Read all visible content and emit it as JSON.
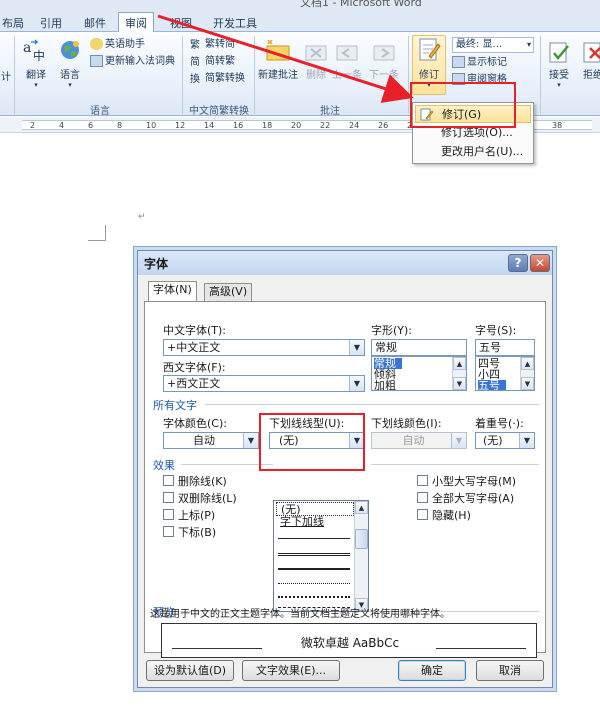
{
  "app": {
    "title": "文档1 - Microsoft Word"
  },
  "ribbon_tabs": [
    "布局",
    "引用",
    "邮件",
    "审阅",
    "视图",
    "开发工具"
  ],
  "ribbon": {
    "proof_group": {
      "label": "语言",
      "translate": "翻译",
      "language": "语言",
      "english_assistant": "英语助手",
      "update_ime": "更新输入法词典",
      "left_cut": "计"
    },
    "chinese_group": {
      "label": "中文简繁转换",
      "to_simplified": "繁转简",
      "to_traditional": "简转繁",
      "convert": "简繁转换"
    },
    "comments_group": {
      "label": "批注",
      "new_comment": "新建批注",
      "delete": "删除",
      "previous": "上一条",
      "next": "下一条"
    },
    "tracking_group": {
      "track_changes": "修订",
      "final_show_markup": "最终: 显...",
      "show_markup": "显示标记",
      "review_pane": "审阅窗格"
    },
    "changes_group": {
      "accept": "接受",
      "reject_cut": "拒绝"
    }
  },
  "ruler": {
    "numbers": [
      "2",
      "4",
      "6",
      "8",
      "10",
      "12",
      "14",
      "16",
      "18",
      "20",
      "22",
      "24",
      "26",
      "28",
      "30",
      "32",
      "34",
      "36",
      "38"
    ]
  },
  "track_menu": {
    "items": [
      "修订(G)",
      "修订选项(O)...",
      "更改用户名(U)..."
    ]
  },
  "font_dialog": {
    "title": "字体",
    "help": "?",
    "close": "✕",
    "tabs": [
      "字体(N)",
      "高级(V)"
    ],
    "chinese_font_label": "中文字体(T):",
    "chinese_font_value": "+中文正文",
    "western_font_label": "西文字体(F):",
    "western_font_value": "+西文正文",
    "style_label": "字形(Y):",
    "style_value": "常规",
    "style_options": [
      "常规",
      "倾斜",
      "加粗"
    ],
    "size_label": "字号(S):",
    "size_value": "五号",
    "size_options": [
      "四号",
      "小四",
      "五号"
    ],
    "all_text_label": "所有文字",
    "color_label": "字体颜色(C):",
    "color_value": "自动",
    "underline_label": "下划线线型(U):",
    "underline_value": "(无)",
    "underline_color_label": "下划线颜色(I):",
    "underline_color_value": "自动",
    "emphasis_label": "着重号(·):",
    "emphasis_value": "(无)",
    "underline_list": {
      "none": "(无)",
      "words_only": "字下加线"
    },
    "effects_label": "效果",
    "effects_left": [
      "删除线(K)",
      "双删除线(L)",
      "上标(P)",
      "下标(B)"
    ],
    "effects_right": [
      "小型大写字母(M)",
      "全部大写字母(A)",
      "隐藏(H)"
    ],
    "preview_label": "预览",
    "preview_sample": "微软卓越 AaBbCc",
    "description": "这是用于中文的正文主题字体。当前文档主题定义将使用哪种字体。",
    "buttons": {
      "set_default": "设为默认值(D)",
      "text_effects": "文字效果(E)...",
      "ok": "确定",
      "cancel": "取消"
    }
  },
  "colors": {
    "accent_red": "#e8202a",
    "ribbon_blue": "#dfe9f5",
    "selection_blue": "#3875d7",
    "section_blue": "#1d5aa8"
  }
}
